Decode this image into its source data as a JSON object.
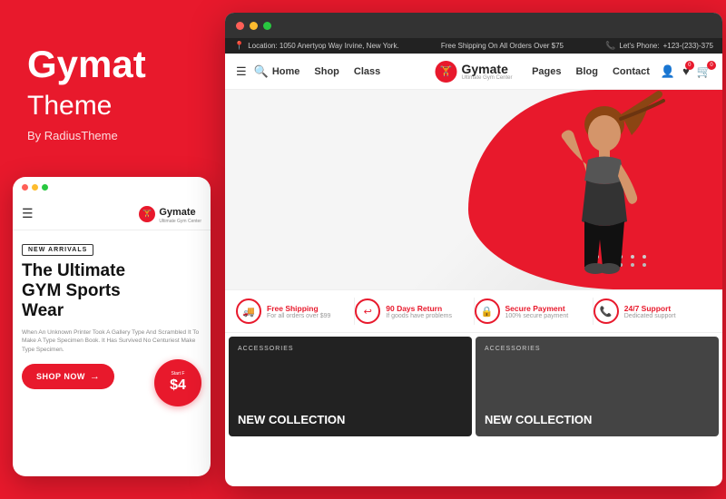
{
  "brand": {
    "name": "Gymat",
    "subtitle": "Theme",
    "by": "By RadiusTheme"
  },
  "mobile": {
    "logo_text": "Gymate",
    "logo_sub": "Ultimate Gym Center",
    "new_arrivals_badge": "NEW ARRIVALS",
    "headline_line1": "The Ultimate",
    "headline_line2": "GYM Sports",
    "headline_line3": "Wear",
    "description": "When An Unknown Printer Took A Gallery Type And Scrambled It To Make A Type Specimen Book. It Has Survived No Centuriest Make Type Specimen.",
    "start_from": "Start F",
    "price": "$4",
    "shop_now": "SHOP NOW"
  },
  "desktop": {
    "top_bar": {
      "location": "Location: 1050 Anertyop Way Irvine, New York.",
      "shipping": "Free Shipping On All Orders Over $75",
      "phone_label": "Let's Phone:",
      "phone": "+123-(233)-375"
    },
    "nav": {
      "menu_items": [
        "Home",
        "Shop",
        "Class"
      ],
      "logo_text": "Gymate",
      "logo_sub": "Ultimate Gym Center",
      "right_links": [
        "Pages",
        "Blog",
        "Contact"
      ]
    },
    "features": [
      {
        "icon": "🚚",
        "title": "Free Shipping",
        "sub": "For all orders over $99"
      },
      {
        "icon": "↩",
        "title": "90 Days Return",
        "sub": "If goods have problems"
      },
      {
        "icon": "🔒",
        "title": "Secure Payment",
        "sub": "100% secure payment"
      },
      {
        "icon": "📞",
        "title": "24/7 Support",
        "sub": "Dedicated support"
      }
    ],
    "products": [
      {
        "category": "ACCESSORIES",
        "title": "NEW COLLECTION"
      },
      {
        "category": "ACCESSORIES",
        "title": "NEW COLLECTION"
      }
    ]
  }
}
